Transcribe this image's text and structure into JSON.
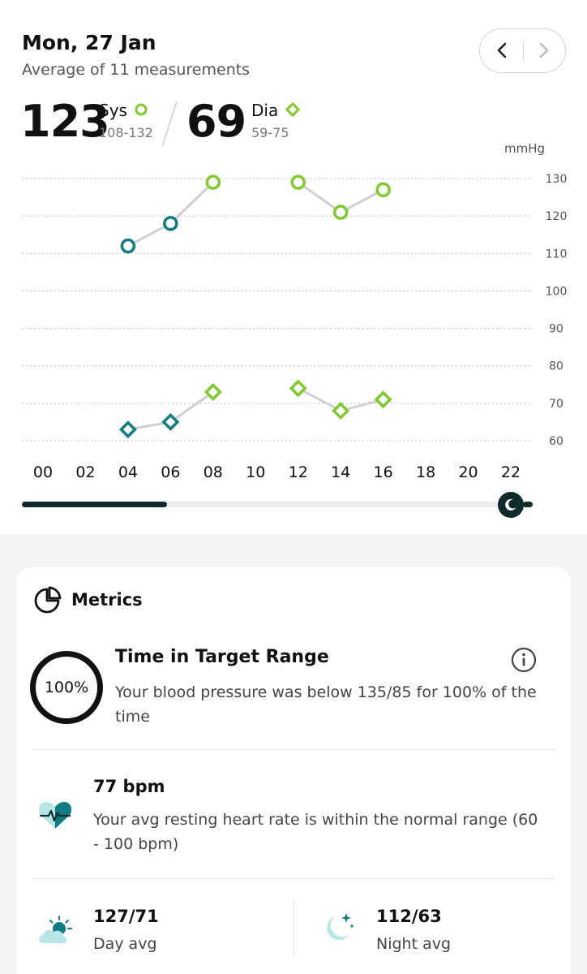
{
  "header": {
    "date": "Mon, 27 Jan",
    "subtitle": "Average of 11 measurements",
    "nav": {
      "prev_icon": "chevron-left-icon",
      "next_icon": "chevron-right-icon"
    }
  },
  "summary": {
    "sys_value": "123",
    "sys_label": "Sys",
    "sys_range": "108-132",
    "dia_value": "69",
    "dia_label": "Dia",
    "dia_range": "59-75"
  },
  "chart_data": {
    "type": "line",
    "ylabel": "mmHg",
    "ylim": [
      60,
      130
    ],
    "y_ticks": [
      "130",
      "120",
      "110",
      "100",
      "90",
      "80",
      "70",
      "60"
    ],
    "x_ticks": [
      "00",
      "02",
      "04",
      "06",
      "08",
      "10",
      "12",
      "14",
      "16",
      "18",
      "20",
      "22"
    ],
    "xlim": [
      0,
      22
    ],
    "grid": true,
    "series": [
      {
        "marker": "circle",
        "segments": [
          [
            {
              "x": 4,
              "y": 112,
              "period": "night"
            },
            {
              "x": 6,
              "y": 118,
              "period": "night"
            },
            {
              "x": 8,
              "y": 129,
              "period": "day"
            }
          ],
          [
            {
              "x": 12,
              "y": 129,
              "period": "day"
            },
            {
              "x": 14,
              "y": 121,
              "period": "day"
            },
            {
              "x": 16,
              "y": 127,
              "period": "day"
            }
          ]
        ]
      },
      {
        "marker": "diamond",
        "segments": [
          [
            {
              "x": 4,
              "y": 63,
              "period": "night"
            },
            {
              "x": 6,
              "y": 65,
              "period": "night"
            },
            {
              "x": 8,
              "y": 73,
              "period": "day"
            }
          ],
          [
            {
              "x": 12,
              "y": 74,
              "period": "day"
            },
            {
              "x": 14,
              "y": 68,
              "period": "day"
            },
            {
              "x": 16,
              "y": 71,
              "period": "day"
            }
          ]
        ]
      }
    ],
    "colors": {
      "day": "#7ecb2b",
      "night": "#0f7c82",
      "line": "#cfcfcf",
      "grid": "#c9c9c9"
    }
  },
  "timeline": {
    "progress": 0.3,
    "thumb_icon": "moon-icon"
  },
  "metrics": {
    "title": "Metrics",
    "icon": "pie-chart-icon",
    "target": {
      "percent": "100%",
      "title": "Time in Target Range",
      "description": "Your blood pressure was below 135/85 for 100% of the time",
      "info_icon": "info-icon"
    },
    "heart": {
      "value": "77 bpm",
      "description": "Your avg resting heart rate is within the normal range (60 - 100 bpm)",
      "icon": "heart-pulse-icon"
    },
    "day_avg": {
      "value": "127/71",
      "label": "Day avg",
      "icon": "sun-cloud-icon"
    },
    "night_avg": {
      "value": "112/63",
      "label": "Night avg",
      "icon": "moon-stars-icon"
    }
  },
  "colors": {
    "accent_green": "#7ecb2b",
    "accent_teal": "#0f7c82",
    "dark": "#0e2a2b",
    "light_teal": "#b7e6e6"
  }
}
